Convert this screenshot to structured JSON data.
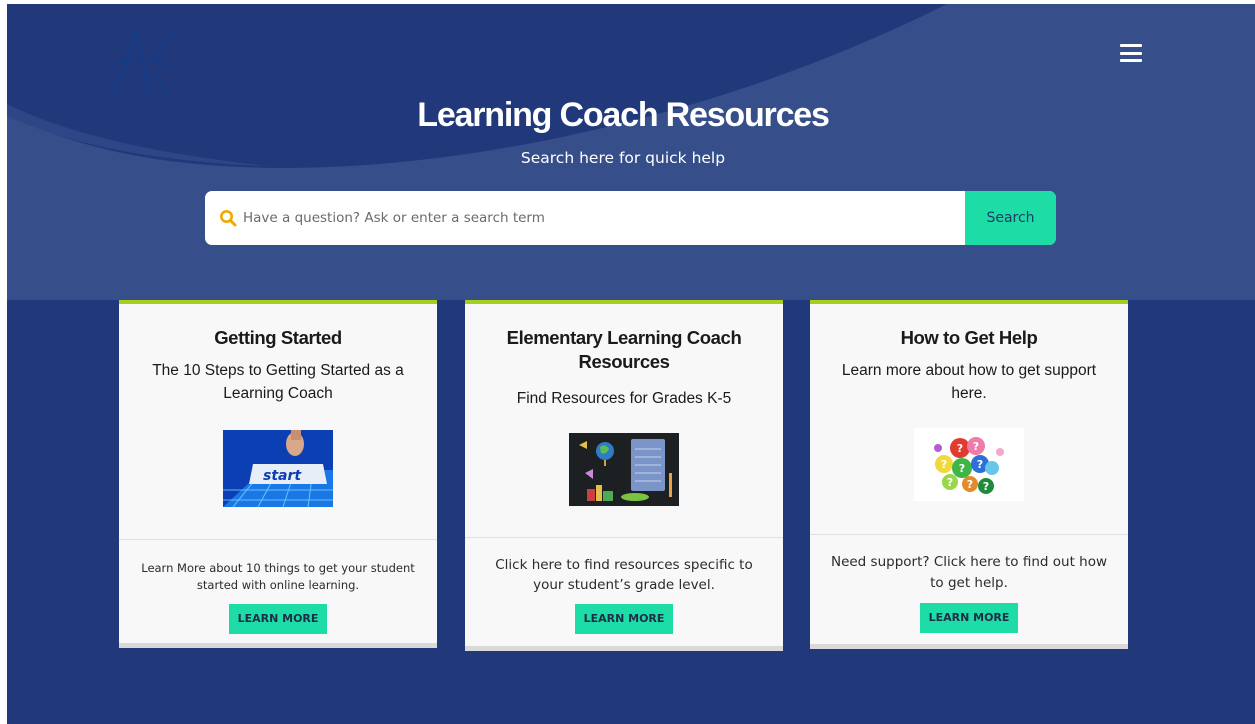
{
  "header": {
    "logo_icon": "academy-logo-icon",
    "menu_icon": "hamburger-menu-icon",
    "title": "Learning Coach Resources",
    "subtitle": "Search here for quick help"
  },
  "search": {
    "icon": "search-icon",
    "placeholder": "Have a question? Ask or enter a search term",
    "button_label": "Search"
  },
  "colors": {
    "background_dark": "#21397a",
    "hero": "#364f8a",
    "accent_green": "#1ddca6",
    "card_top_border": "#a6cf1d",
    "search_icon": "#f2a800"
  },
  "cards": [
    {
      "title": "Getting Started",
      "description": "The 10 Steps to Getting Started as a Learning Coach",
      "image_icon": "start-key-image",
      "footer_text": "Learn More about 10 things to get your student started with online learning.",
      "button_label": "LEARN MORE"
    },
    {
      "title": "Elementary Learning Coach Resources",
      "description": "Find Resources for Grades K-5",
      "image_icon": "classroom-chalkboard-image",
      "footer_text": "Click here to find resources specific to your student’s grade level.",
      "button_label": "LEARN MORE"
    },
    {
      "title": "How to Get Help",
      "description": "Learn more about how to get support here.",
      "image_icon": "question-marks-image",
      "footer_text": "Need support? Click here to find out how to get help.",
      "button_label": "LEARN MORE"
    }
  ]
}
